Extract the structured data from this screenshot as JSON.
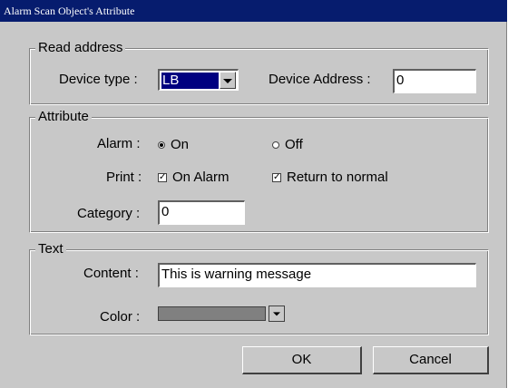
{
  "window": {
    "title": "Alarm Scan Object's Attribute"
  },
  "read_address": {
    "legend": "Read address",
    "device_type_label": "Device type :",
    "device_type_value": "LB",
    "device_address_label": "Device Address :",
    "device_address_value": "0"
  },
  "attribute": {
    "legend": "Attribute",
    "alarm_label": "Alarm :",
    "alarm_on": "On",
    "alarm_off": "Off",
    "alarm_selected": "On",
    "print_label": "Print :",
    "print_on_alarm": "On Alarm",
    "print_on_alarm_checked": true,
    "print_return": "Return to normal",
    "print_return_checked": true,
    "category_label": "Category :",
    "category_value": "0"
  },
  "text": {
    "legend": "Text",
    "content_label": "Content :",
    "content_value": "This is warning message",
    "color_label": "Color :",
    "color_value": "#808080"
  },
  "buttons": {
    "ok": "OK",
    "cancel": "Cancel"
  }
}
